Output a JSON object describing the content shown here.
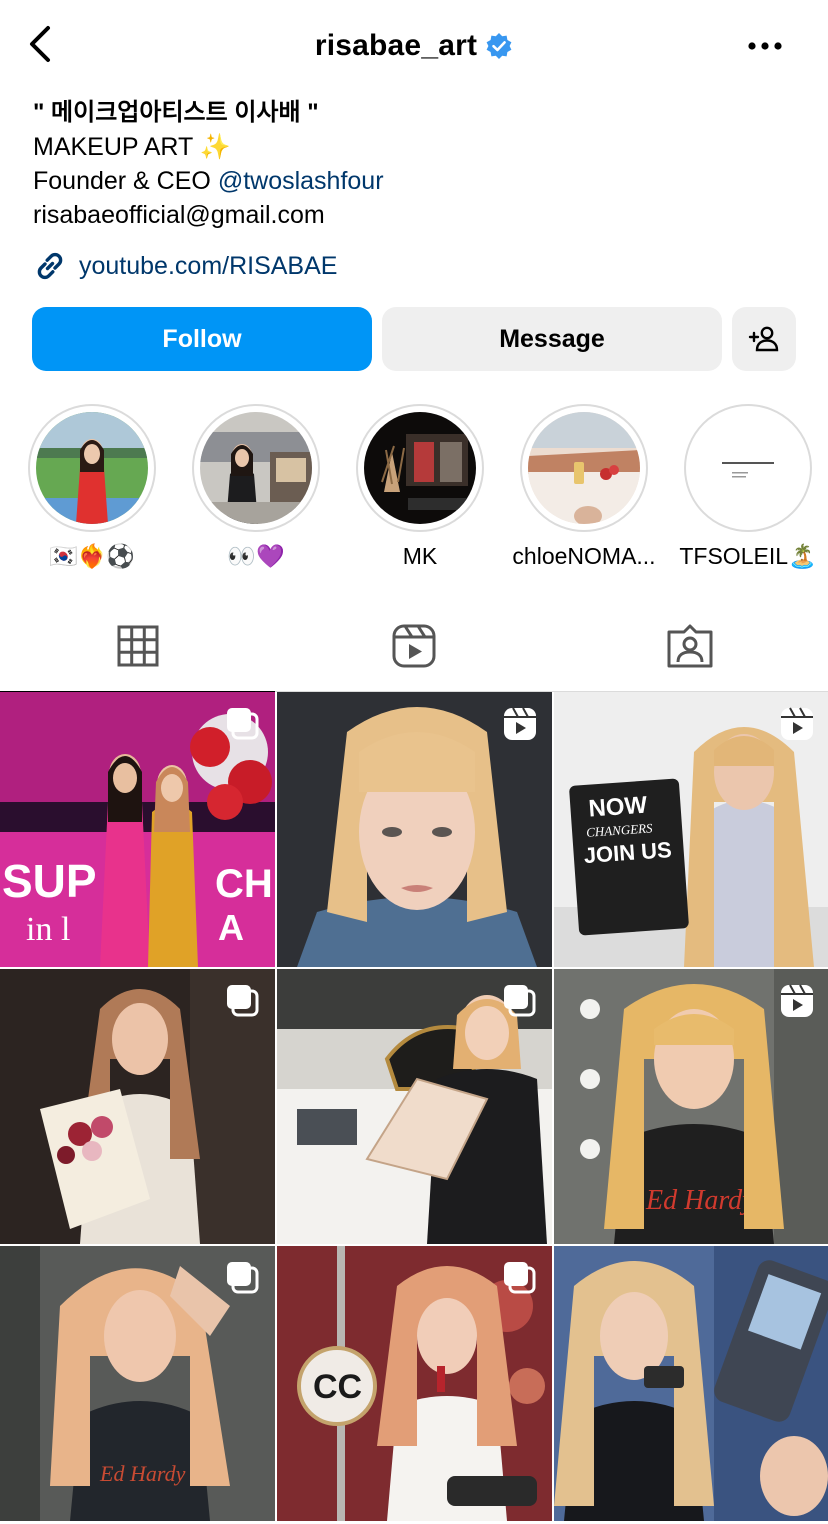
{
  "header": {
    "username": "risabae_art",
    "back_icon": "chevron-left-icon",
    "verified_icon": "verified-badge-icon",
    "more_icon": "more-horizontal-icon"
  },
  "bio": {
    "name": "\" 메이크업아티스트 이사배 \"",
    "line1": "MAKEUP ART ✨",
    "line2_prefix": "Founder & CEO ",
    "line2_mention": "@twoslashfour",
    "line3": "risabaeofficial@gmail.com",
    "link": "youtube.com/RISABAE",
    "link_icon": "link-icon"
  },
  "actions": {
    "follow_label": "Follow",
    "message_label": "Message",
    "add_icon": "add-person-icon"
  },
  "highlights": [
    {
      "label": "🇰🇷❤️‍🔥⚽"
    },
    {
      "label": "👀💜"
    },
    {
      "label": "MK"
    },
    {
      "label": "chloeNOMA..."
    },
    {
      "label": "TFSOLEIL🏝️"
    }
  ],
  "tabs": [
    {
      "name": "posts",
      "icon": "grid-icon"
    },
    {
      "name": "reels",
      "icon": "reels-icon"
    },
    {
      "name": "tagged",
      "icon": "tagged-icon"
    }
  ],
  "colors": {
    "accent": "#0095f6",
    "link": "#00376b",
    "button_secondary": "#efefef",
    "verified": "#3897f0"
  }
}
